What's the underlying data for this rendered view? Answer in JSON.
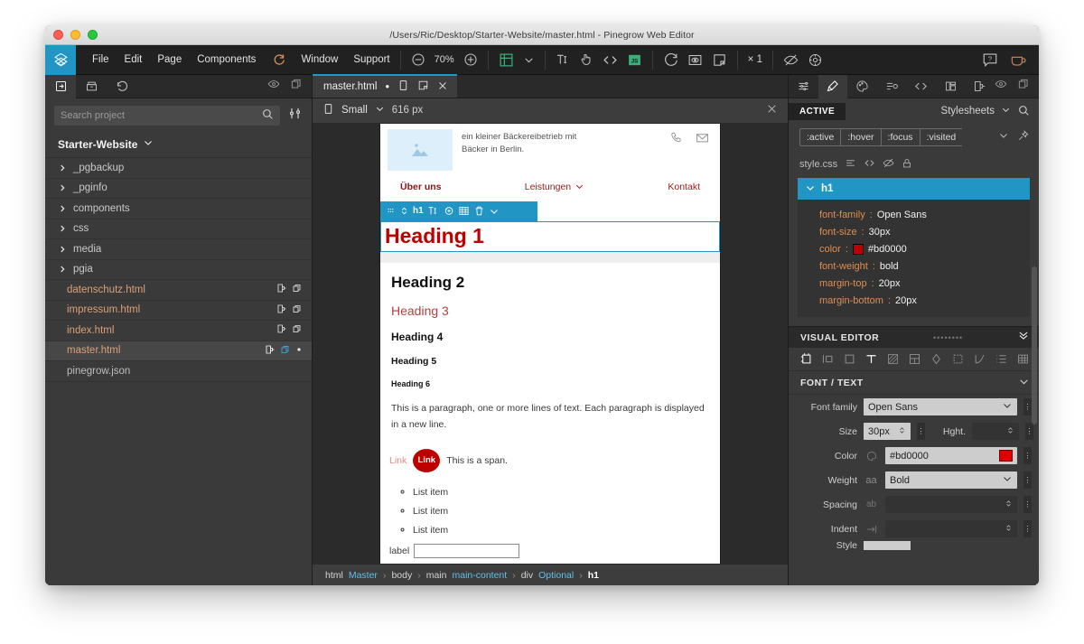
{
  "window": {
    "title": "/Users/Ric/Desktop/Starter-Website/master.html - Pinegrow Web Editor"
  },
  "menubar": {
    "items": [
      "File",
      "Edit",
      "Page",
      "Components",
      "Window",
      "Support"
    ],
    "zoom": "70%",
    "multiplier": "× 1"
  },
  "left_panel": {
    "search": {
      "placeholder": "Search project",
      "value": ""
    },
    "project_name": "Starter-Website",
    "tree": [
      {
        "label": "_pgbackup",
        "type": "folder"
      },
      {
        "label": "_pginfo",
        "type": "folder"
      },
      {
        "label": "components",
        "type": "folder"
      },
      {
        "label": "css",
        "type": "folder"
      },
      {
        "label": "media",
        "type": "folder"
      },
      {
        "label": "pgia",
        "type": "folder"
      },
      {
        "label": "datenschutz.html",
        "type": "file",
        "selected": false
      },
      {
        "label": "impressum.html",
        "type": "file",
        "selected": false
      },
      {
        "label": "index.html",
        "type": "file",
        "selected": false
      },
      {
        "label": "master.html",
        "type": "file",
        "selected": true
      },
      {
        "label": "pinegrow.json",
        "type": "json",
        "selected": false
      }
    ]
  },
  "center_panel": {
    "tab": {
      "label": "master.html",
      "dirty": "•"
    },
    "viewport": {
      "size_label": "Small",
      "width": "616 px"
    },
    "element_toolbar": {
      "tag": "h1"
    },
    "preview": {
      "blurb_line1": "ein kleiner Bäckereibetrieb mit",
      "blurb_line2": "Bäcker in Berlin.",
      "nav": [
        {
          "label": "Über uns",
          "active": true,
          "dropdown": false
        },
        {
          "label": "Leistungen",
          "active": false,
          "dropdown": true
        },
        {
          "label": "Kontakt",
          "active": false,
          "dropdown": false
        }
      ],
      "h1": "Heading 1",
      "h2": "Heading 2",
      "h3": "Heading 3",
      "h4": "Heading 4",
      "h5": "Heading 5",
      "h6": "Heading 6",
      "paragraph": "This is a paragraph, one or more lines of text. Each paragraph is displayed in a new line.",
      "link_plain": "Link",
      "link_button": "Link",
      "span_text": "This is a span.",
      "list_items": [
        "List item",
        "List item",
        "List item"
      ],
      "form_label": "label",
      "form_value": ""
    },
    "breadcrumb": [
      {
        "tag": "html",
        "cls": "Master"
      },
      {
        "tag": "body",
        "cls": ""
      },
      {
        "tag": "main",
        "cls": "main-content"
      },
      {
        "tag": "div",
        "cls": "Optional"
      },
      {
        "tag": "h1",
        "cls": "",
        "selected": true
      }
    ]
  },
  "right_panel": {
    "active_badge": "ACTIVE",
    "stylesheets_label": "Stylesheets",
    "pseudo_classes": [
      ":active",
      ":hover",
      ":focus",
      ":visited"
    ],
    "stylesheet_file": "style.css",
    "rule": {
      "selector": "h1",
      "declarations": [
        {
          "prop": "font-family",
          "value": "Open Sans",
          "swatch": null
        },
        {
          "prop": "font-size",
          "value": "30px",
          "swatch": null
        },
        {
          "prop": "color",
          "value": "#bd0000",
          "swatch": "#bd0000"
        },
        {
          "prop": "font-weight",
          "value": "bold",
          "swatch": null
        },
        {
          "prop": "margin-top",
          "value": "20px",
          "swatch": null
        },
        {
          "prop": "margin-bottom",
          "value": "20px",
          "swatch": null
        }
      ]
    },
    "visual_editor": {
      "title": "VISUAL EDITOR",
      "section_title": "FONT / TEXT",
      "fields": {
        "font_family_label": "Font family",
        "font_family_value": "Open Sans",
        "size_label": "Size",
        "size_value": "30px",
        "height_label": "Hght.",
        "height_value": "",
        "color_label": "Color",
        "color_value": "#bd0000",
        "color_swatch": "#bd0000",
        "weight_label": "Weight",
        "weight_value": "Bold",
        "spacing_label": "Spacing",
        "spacing_value": "",
        "indent_label": "Indent",
        "indent_value": "",
        "style_label": "Style"
      }
    }
  }
}
